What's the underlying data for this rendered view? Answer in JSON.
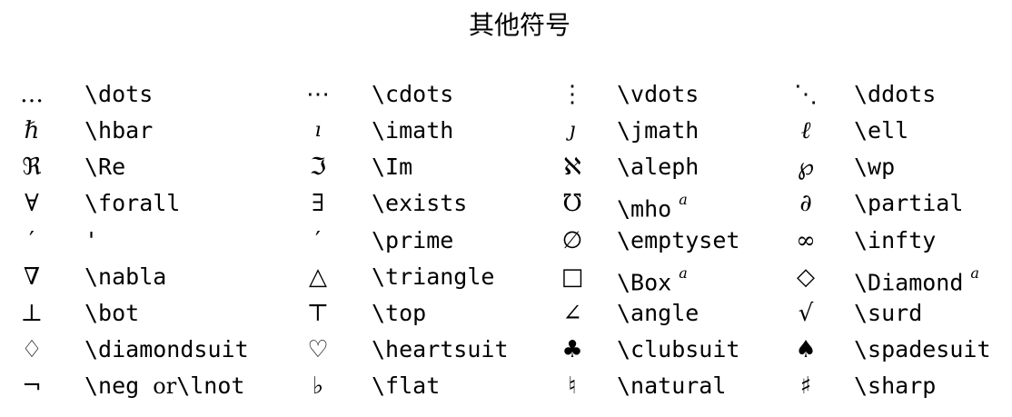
{
  "title": "其他符号",
  "rows": [
    [
      {
        "symbol": "…",
        "command": "\\dots"
      },
      {
        "symbol": "⋯",
        "command": "\\cdots"
      },
      {
        "symbol": "⋮",
        "command": "\\vdots"
      },
      {
        "symbol": "⋱",
        "command": "\\ddots"
      }
    ],
    [
      {
        "symbol": "ℏ",
        "command": "\\hbar"
      },
      {
        "symbol": "ı",
        "command": "\\imath"
      },
      {
        "symbol": "ȷ",
        "command": "\\jmath"
      },
      {
        "symbol": "ℓ",
        "command": "\\ell"
      }
    ],
    [
      {
        "symbol": "ℜ",
        "command": "\\Re"
      },
      {
        "symbol": "ℑ",
        "command": "\\Im"
      },
      {
        "symbol": "ℵ",
        "command": "\\aleph"
      },
      {
        "symbol": "℘",
        "command": "\\wp"
      }
    ],
    [
      {
        "symbol": "∀",
        "command": "\\forall"
      },
      {
        "symbol": "∃",
        "command": "\\exists"
      },
      {
        "symbol": "℧",
        "command": "\\mho",
        "note": "a"
      },
      {
        "symbol": "∂",
        "command": "\\partial"
      }
    ],
    [
      {
        "symbol": "′",
        "command": "'"
      },
      {
        "symbol": "′",
        "command": "\\prime"
      },
      {
        "symbol": "∅",
        "command": "\\emptyset"
      },
      {
        "symbol": "∞",
        "command": "\\infty"
      }
    ],
    [
      {
        "symbol": "∇",
        "command": "\\nabla"
      },
      {
        "symbol": "△",
        "command": "\\triangle"
      },
      {
        "symbol": "□",
        "command": "\\Box",
        "note": "a"
      },
      {
        "symbol": "◇",
        "command": "\\Diamond",
        "note": "a"
      }
    ],
    [
      {
        "symbol": "⊥",
        "command": "\\bot"
      },
      {
        "symbol": "⊤",
        "command": "\\top"
      },
      {
        "symbol": "∠",
        "command": "\\angle"
      },
      {
        "symbol": "√",
        "command": "\\surd"
      }
    ],
    [
      {
        "symbol": "♢",
        "command": "\\diamondsuit"
      },
      {
        "symbol": "♡",
        "command": "\\heartsuit"
      },
      {
        "symbol": "♣",
        "command": "\\clubsuit"
      },
      {
        "symbol": "♠",
        "command": "\\spadesuit"
      }
    ],
    [
      {
        "symbol": "¬",
        "command": "\\neg",
        "or_text": "or",
        "alt_command": "\\lnot"
      },
      {
        "symbol": "♭",
        "command": "\\flat"
      },
      {
        "symbol": "♮",
        "command": "\\natural"
      },
      {
        "symbol": "♯",
        "command": "\\sharp"
      }
    ]
  ]
}
